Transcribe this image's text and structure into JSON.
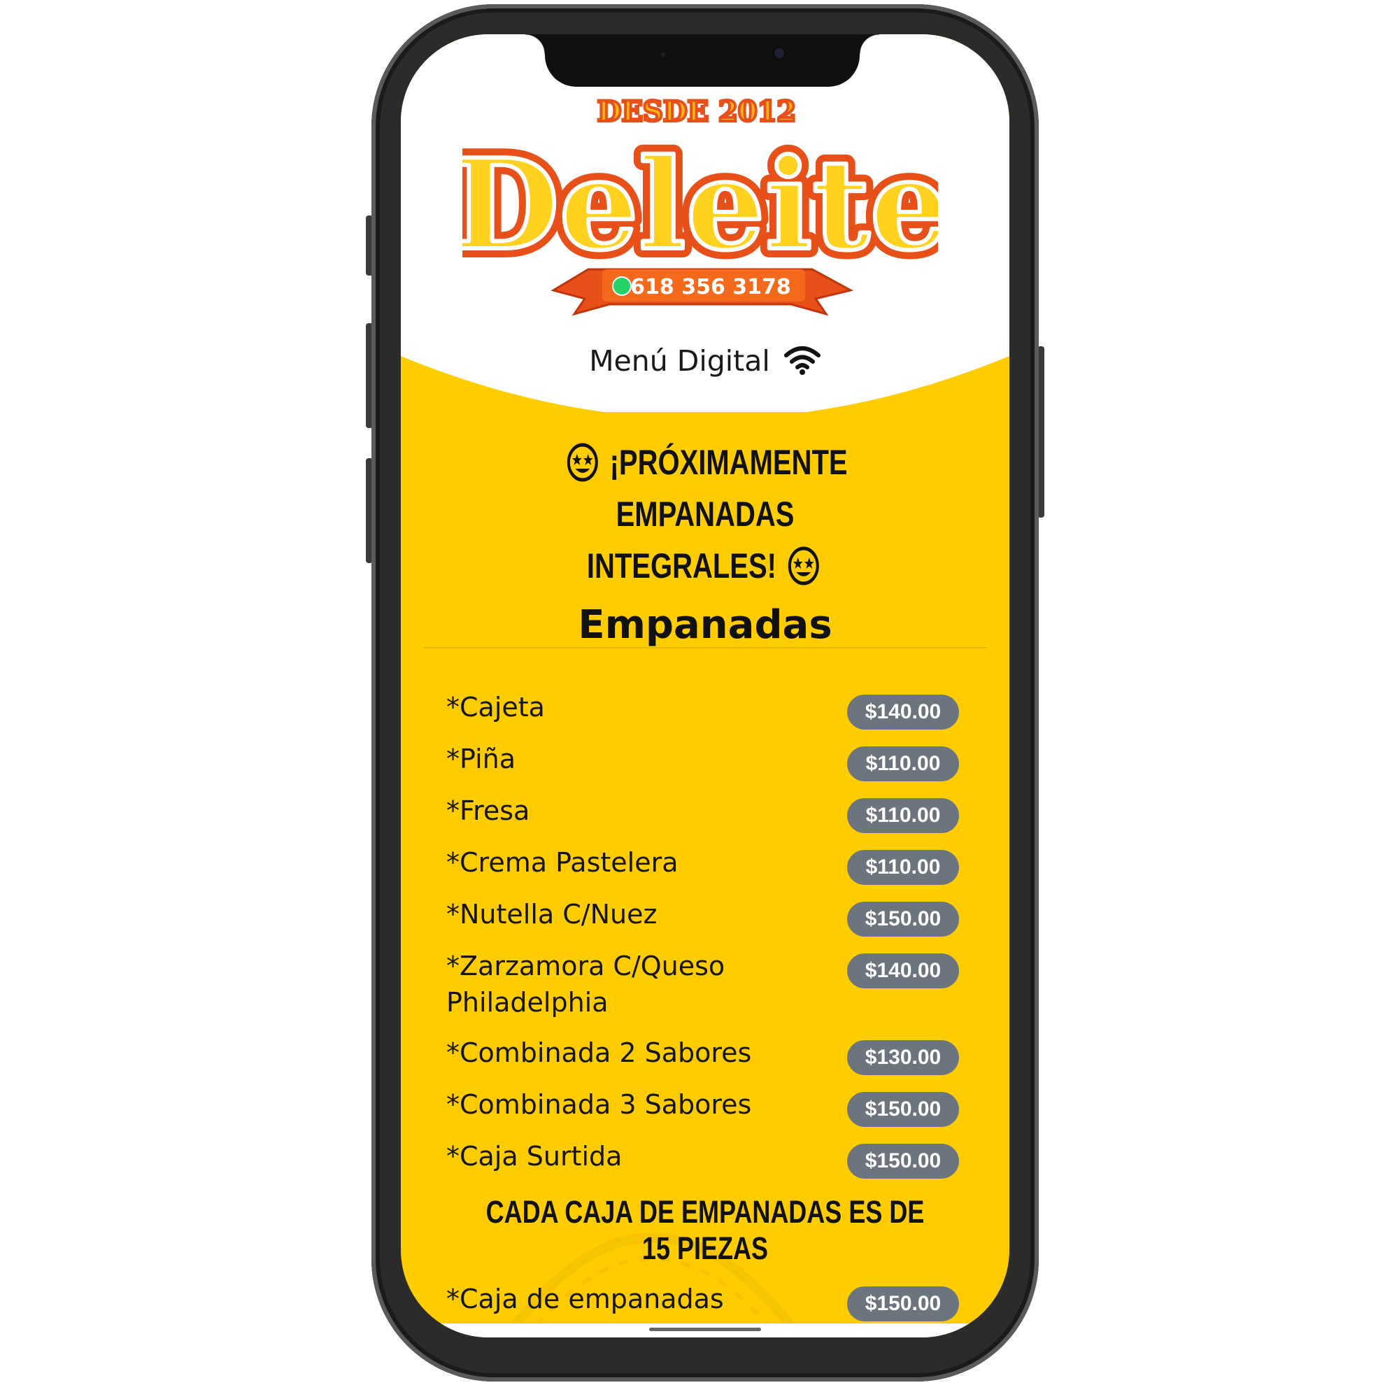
{
  "logo": {
    "since": "DESDE 2012",
    "brand": "Deleite",
    "phone": "618 356 3178"
  },
  "header": {
    "menu_label": "Menú Digital"
  },
  "announcement": {
    "line1": "¡PRÓXIMAMENTE EMPANADAS",
    "line2": "INTEGRALES!"
  },
  "section": {
    "title": "Empanadas"
  },
  "items": [
    {
      "name": "*Cajeta",
      "price": "$140.00"
    },
    {
      "name": "*Piña",
      "price": "$110.00"
    },
    {
      "name": "*Fresa",
      "price": "$110.00"
    },
    {
      "name": "*Crema Pastelera",
      "price": "$110.00"
    },
    {
      "name": "*Nutella C/Nuez",
      "price": "$150.00"
    },
    {
      "name": "*Zarzamora C/Queso Philadelphia",
      "price": "$140.00"
    },
    {
      "name": "*Combinada 2 Sabores",
      "price": "$130.00"
    },
    {
      "name": "*Combinada 3 Sabores",
      "price": "$150.00"
    },
    {
      "name": "*Caja Surtida",
      "price": "$150.00"
    }
  ],
  "note": "CADA CAJA DE EMPANADAS ES DE 15 PIEZAS",
  "items2": [
    {
      "name": "*Caja de empanadas chicas (cualquier sabor",
      "price": "$150.00"
    }
  ],
  "colors": {
    "background": "#ffcc00",
    "price_badge": "#6c757d",
    "logo_orange": "#f05a14",
    "logo_yellow": "#ffd21f"
  },
  "icons": {
    "wifi": "wifi-icon",
    "emoji": "star-struck-emoji-icon",
    "whatsapp": "whatsapp-icon"
  }
}
